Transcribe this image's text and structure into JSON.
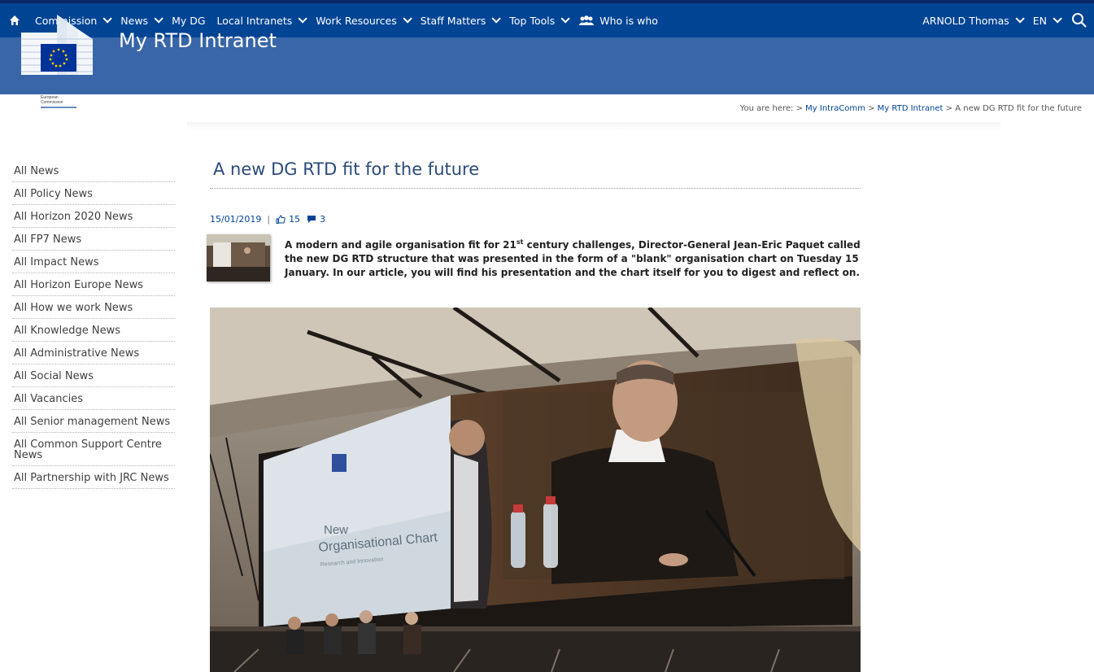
{
  "nav": {
    "items": [
      {
        "label": "Commission",
        "dropdown": true
      },
      {
        "label": "News",
        "dropdown": true
      },
      {
        "label": "My DG",
        "dropdown": false
      },
      {
        "label": "Local Intranets",
        "dropdown": true
      },
      {
        "label": "Work Resources",
        "dropdown": true
      },
      {
        "label": "Staff Matters",
        "dropdown": true
      },
      {
        "label": "Top Tools",
        "dropdown": true
      }
    ],
    "who_is_who": "Who is who",
    "user": "ARNOLD Thomas",
    "language": "EN"
  },
  "banner": {
    "site_title": "My RTD Intranet",
    "logo_line1": "European",
    "logo_line2": "Commission"
  },
  "breadcrumb": {
    "prefix": "You are here:",
    "link1": "My IntraComm",
    "link2": "My RTD Intranet",
    "current": "A new DG RTD fit for the future"
  },
  "sidebar": {
    "items": [
      "All News",
      "All Policy News",
      "All Horizon 2020 News",
      "All FP7 News",
      "All Impact News",
      "All Horizon Europe News",
      "All How we work News",
      "All Knowledge News",
      "All Administrative News",
      "All Social News",
      "All Vacancies",
      "All Senior management News",
      "All Common Support Centre News",
      "All Partnership with JRC News"
    ]
  },
  "article": {
    "title": "A new DG RTD fit for the future",
    "date": "15/01/2019",
    "likes": "15",
    "comments": "3",
    "summary_part1": "A modern and agile organisation fit for 21",
    "summary_sup": "st",
    "summary_part2": " century challenges, Director-General Jean-Eric Paquet called the new DG RTD structure that was presented in the form of a \"blank\" organisation chart on Tuesday 15 January.  In our article, you will find his presentation and the chart itself for you to digest and reflect on.",
    "slide_line1": "New",
    "slide_line2": "Organisational Chart",
    "slide_line3": "Research and Innovation"
  },
  "colors": {
    "nav_bg": "#004494",
    "banner_bg": "#3966a8",
    "link": "#004494",
    "title": "#2b4a7a"
  }
}
